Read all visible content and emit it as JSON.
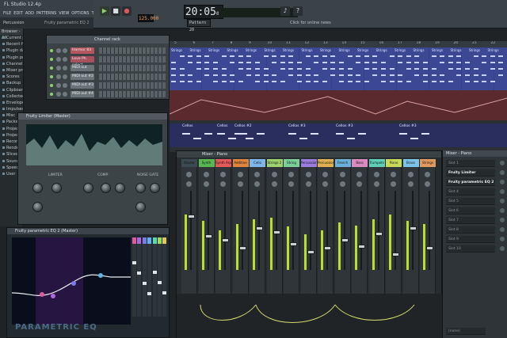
{
  "title": "FL Studio 12.4p",
  "menu": [
    "FILE",
    "EDIT",
    "ADD",
    "PATTERNS",
    "VIEW",
    "OPTIONS",
    "TOOLS",
    "?"
  ],
  "hint": {
    "label": "Percussion",
    "text": "Fruity parametric EQ 2"
  },
  "transport": {
    "bpm": "125.000",
    "time": "20:05",
    "time_small": "09",
    "pattern": "Pattern 20",
    "online": "Click for online news"
  },
  "browser": {
    "header": "Browser - All",
    "items": [
      "Current project",
      "Recent files",
      "Plugin database",
      "Plugin presets",
      "Channel presets",
      "Mixer presets",
      "Scores",
      "Backup",
      "Clipboard files",
      "Collected",
      "Envelopes",
      "Impulses",
      "Misc",
      "Packs",
      "Projects",
      "Project bones",
      "Recorded",
      "Rendered",
      "Sliced beats",
      "Soundfonts",
      "Speech",
      "User"
    ]
  },
  "rack": {
    "title": "Channel rack",
    "filter": "All",
    "swing": "Swing",
    "channels": [
      {
        "name": "Harmor 83",
        "color": "#b5565f"
      },
      {
        "name": "Love Ph. select",
        "color": "#a8505c"
      },
      {
        "name": "MIDI out",
        "color": "#6a7378"
      },
      {
        "name": "MIDI out #2",
        "color": "#6a7378"
      },
      {
        "name": "MIDI out #3",
        "color": "#6a7378"
      },
      {
        "name": "MIDI out #4",
        "color": "#6a7378"
      }
    ]
  },
  "playlist": {
    "ruler": [
      "5",
      "6",
      "7",
      "8",
      "9",
      "10",
      "11",
      "12",
      "13",
      "14",
      "15",
      "16",
      "17",
      "18",
      "19",
      "20",
      "21",
      "22"
    ],
    "clip_label": "Strings",
    "cello_labels": [
      "Cellos",
      "Cellos",
      "Cellos #2",
      "Cellos #3",
      "Cellos #3",
      "Cellos #3"
    ]
  },
  "limiter": {
    "title": "Fruity Limiter (Master)",
    "sections": [
      "LIMITER",
      "COMP",
      "NOISE GATE"
    ]
  },
  "eq": {
    "title": "Fruity parametric EQ 2 (Master)",
    "logo": "PARAMETRIC EQ",
    "band_colors": [
      "#e05b9b",
      "#b066e0",
      "#7a7be6",
      "#5fb2ea",
      "#5ed6b4",
      "#9bd95f",
      "#e0c85a"
    ]
  },
  "mixer": {
    "title": "Mixer - Piano",
    "tracks": [
      {
        "name": "Master",
        "color": "#3b4a52"
      },
      {
        "name": "Synth",
        "color": "#58b850"
      },
      {
        "name": "Synth Arp",
        "color": "#e25a5a"
      },
      {
        "name": "Additive",
        "color": "#e0853f"
      },
      {
        "name": "Cello",
        "color": "#7fb6ea"
      },
      {
        "name": "Strings 2",
        "color": "#a0d36b"
      },
      {
        "name": "String section",
        "color": "#7bd09a"
      },
      {
        "name": "Percussion",
        "color": "#9b7de0"
      },
      {
        "name": "Percussion 2",
        "color": "#e0b050"
      },
      {
        "name": "French Horn",
        "color": "#6bb0d9"
      },
      {
        "name": "Bass Drum",
        "color": "#d98ac0"
      },
      {
        "name": "Trumpets",
        "color": "#5fd0b8"
      },
      {
        "name": "Piano",
        "color": "#c6d95a"
      },
      {
        "name": "Brass",
        "color": "#7bc3e8"
      },
      {
        "name": "Strings",
        "color": "#e09a5f"
      }
    ],
    "fader_levels": [
      0.7,
      0.45,
      0.4,
      0.3,
      0.55,
      0.5,
      0.35,
      0.25,
      0.3,
      0.4,
      0.32,
      0.48,
      0.22,
      0.55,
      0.3
    ],
    "meter_levels": [
      0.7,
      0.62,
      0.5,
      0.58,
      0.64,
      0.66,
      0.55,
      0.45,
      0.5,
      0.6,
      0.56,
      0.64,
      0.7,
      0.62,
      0.58
    ]
  },
  "mixer_panel": {
    "title": "Mixer - Piano",
    "slots": [
      {
        "label": "Slot 1",
        "active": false
      },
      {
        "label": "Fruity Limiter",
        "active": true
      },
      {
        "label": "Fruity parametric EQ 2",
        "active": true
      },
      {
        "label": "Slot 4",
        "active": false
      },
      {
        "label": "Slot 5",
        "active": false
      },
      {
        "label": "Slot 6",
        "active": false
      },
      {
        "label": "Slot 7",
        "active": false
      },
      {
        "label": "Slot 8",
        "active": false
      },
      {
        "label": "Slot 9",
        "active": false
      },
      {
        "label": "Slot 10",
        "active": false
      }
    ],
    "output": "(none)"
  }
}
